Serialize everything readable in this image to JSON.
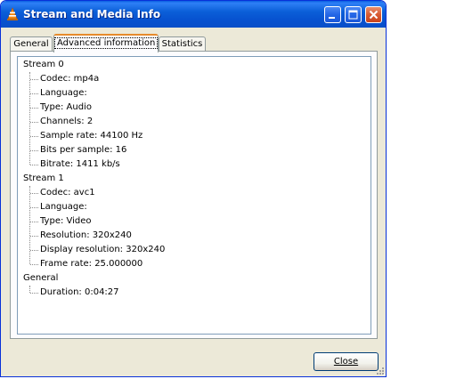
{
  "window": {
    "title": "Stream and Media Info",
    "accent_color": "#0a5fe0",
    "icon": "vlc-cone-icon"
  },
  "titlebar_buttons": {
    "minimize_icon": "minimize-icon",
    "maximize_icon": "maximize-icon",
    "close_icon": "close-icon"
  },
  "tabs": [
    {
      "label": "General",
      "active": false
    },
    {
      "label": "Advanced information",
      "active": true
    },
    {
      "label": "Statistics",
      "active": false
    }
  ],
  "tree": [
    {
      "label": "Stream 0",
      "children": [
        "Codec: mp4a",
        "Language:",
        "Type: Audio",
        "Channels: 2",
        "Sample rate: 44100 Hz",
        "Bits per sample: 16",
        "Bitrate: 1411 kb/s"
      ]
    },
    {
      "label": "Stream 1",
      "children": [
        "Codec: avc1",
        "Language:",
        "Type: Video",
        "Resolution: 320x240",
        "Display resolution: 320x240",
        "Frame rate: 25.000000"
      ]
    },
    {
      "label": "General",
      "children": [
        "Duration: 0:04:27"
      ]
    }
  ],
  "footer": {
    "close_label": "Close",
    "close_mnemonic": "C"
  }
}
